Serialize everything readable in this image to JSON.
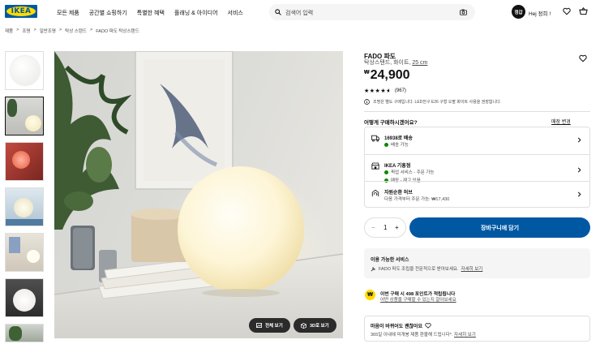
{
  "header": {
    "logo": "IKEA",
    "nav": [
      "모든 제품",
      "공간별 쇼핑하기",
      "특별한 혜택",
      "플래닝 & 아이디어",
      "서비스"
    ],
    "search_placeholder": "검색어 입력",
    "user_badge": "정갑",
    "greeting": "Hej 정희 !"
  },
  "breadcrumb": [
    "제품",
    "조명",
    "일반조명",
    "탁상 스탠드",
    "FADO 파도 탁상스탠드"
  ],
  "gallery": {
    "buttons": [
      "전체 보기",
      "3D로 보기"
    ],
    "selected_thumb": 1
  },
  "product": {
    "name": "FADO 파도",
    "desc_prefix": "탁상스탠드, 화이트,",
    "size": "25 cm",
    "currency": "₩",
    "price": "24,900",
    "rating": 4.5,
    "stars": "★★★★★",
    "reviews": "(967)",
    "bulb_notice": "조명은 별도 구매입니다. LED전구 E26 구형 오팔 화이트 사용을 권장합니다."
  },
  "purchase": {
    "heading": "어떻게 구매하시겠어요?",
    "change_store": "매장 변경",
    "options": [
      {
        "title": "16938로 배송",
        "status": "배송 가능",
        "status2": ""
      },
      {
        "title": "IKEA 기흥점",
        "status": "픽업 서비스 - 주문 가능",
        "status2": "매장 - 재고 있음"
      },
      {
        "title": "자원순환 허브",
        "status": "다음 가격부터 주문 가능: ₩17,430",
        "status2": ""
      }
    ],
    "quantity": "1",
    "minus": "−",
    "plus": "+",
    "add_to_cart": "장바구니에 담기"
  },
  "services": {
    "title": "이용 가능한 서비스",
    "desc": "FADO 파도 조립을 전문적으로 받아보세요.",
    "link": "자세히 보기"
  },
  "points": {
    "line1": "이번 구매 시 498 포인트가 적립됩니다",
    "line2": "어떤 상품을 구매할 수 있는지 알아보세요"
  },
  "returns": {
    "title": "마음이 바뀌어도 괜찮아요",
    "desc": "365일 이내에 미개봉 제품 환불해 드립니다*.",
    "link": "자세히 보기"
  },
  "colors": {
    "ikea_blue": "#0058a3",
    "ikea_yellow": "#ffdb00",
    "in_stock_green": "#0a8a00"
  }
}
